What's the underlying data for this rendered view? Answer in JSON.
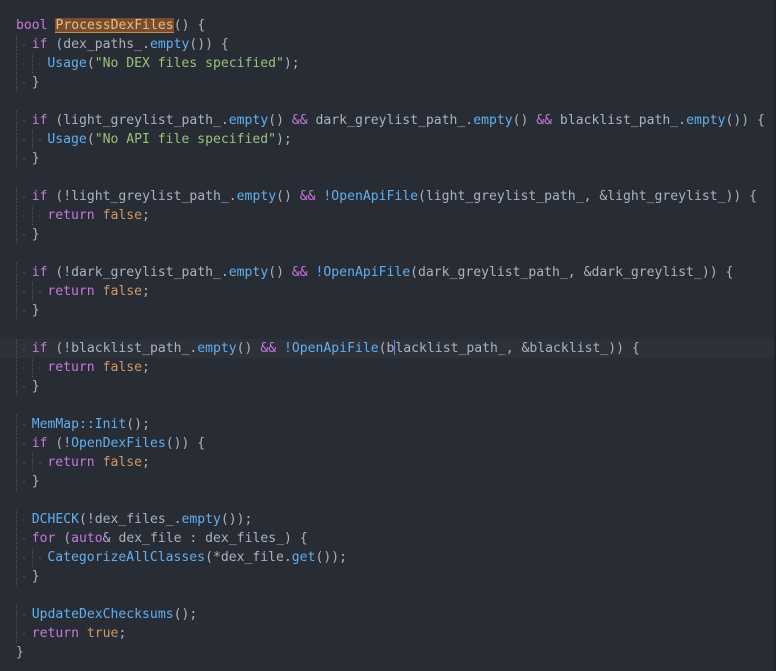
{
  "editor": {
    "language": "cpp",
    "theme": {
      "background": "#282c34",
      "current_line": "#2c313a",
      "keyword": "#c678dd",
      "function": "#61afef",
      "string": "#98c379",
      "constant": "#d19a66",
      "highlight": "#7a4d2e"
    },
    "lines": [
      {
        "indent": 0,
        "tokens": [
          [
            "kw",
            "bool"
          ],
          [
            "txt",
            " "
          ],
          [
            "hl",
            "ProcessDexFiles"
          ],
          [
            "txt",
            "() {"
          ]
        ]
      },
      {
        "indent": 1,
        "tokens": [
          [
            "kw",
            "if"
          ],
          [
            "txt",
            " (dex_paths_."
          ],
          [
            "fn",
            "empty"
          ],
          [
            "txt",
            "()) {"
          ]
        ]
      },
      {
        "indent": 2,
        "tokens": [
          [
            "fn",
            "Usage"
          ],
          [
            "txt",
            "("
          ],
          [
            "str",
            "\"No DEX files specified\""
          ],
          [
            "txt",
            ");"
          ]
        ]
      },
      {
        "indent": 1,
        "tokens": [
          [
            "txt",
            "}"
          ]
        ]
      },
      {
        "indent": 0,
        "tokens": []
      },
      {
        "indent": 1,
        "tokens": [
          [
            "kw",
            "if"
          ],
          [
            "txt",
            " (light_greylist_path_."
          ],
          [
            "fn",
            "empty"
          ],
          [
            "txt",
            "() "
          ],
          [
            "kw",
            "&&"
          ],
          [
            "txt",
            " dark_greylist_path_."
          ],
          [
            "fn",
            "empty"
          ],
          [
            "txt",
            "() "
          ],
          [
            "kw",
            "&&"
          ],
          [
            "txt",
            " blacklist_path_."
          ],
          [
            "fn",
            "empty"
          ],
          [
            "txt",
            "()) {"
          ]
        ]
      },
      {
        "indent": 2,
        "tokens": [
          [
            "fn",
            "Usage"
          ],
          [
            "txt",
            "("
          ],
          [
            "str",
            "\"No API file specified\""
          ],
          [
            "txt",
            ");"
          ]
        ]
      },
      {
        "indent": 1,
        "tokens": [
          [
            "txt",
            "}"
          ]
        ]
      },
      {
        "indent": 0,
        "tokens": []
      },
      {
        "indent": 1,
        "tokens": [
          [
            "kw",
            "if"
          ],
          [
            "txt",
            " (!light_greylist_path_."
          ],
          [
            "fn",
            "empty"
          ],
          [
            "txt",
            "() "
          ],
          [
            "kw",
            "&&"
          ],
          [
            "txt",
            " "
          ],
          [
            "fn",
            "!OpenApiFile"
          ],
          [
            "txt",
            "(light_greylist_path_, &light_greylist_)) {"
          ]
        ]
      },
      {
        "indent": 2,
        "tokens": [
          [
            "kw",
            "return"
          ],
          [
            "txt",
            " "
          ],
          [
            "bool",
            "false"
          ],
          [
            "txt",
            ";"
          ]
        ]
      },
      {
        "indent": 1,
        "tokens": [
          [
            "txt",
            "}"
          ]
        ]
      },
      {
        "indent": 0,
        "tokens": []
      },
      {
        "indent": 1,
        "tokens": [
          [
            "kw",
            "if"
          ],
          [
            "txt",
            " (!dark_greylist_path_."
          ],
          [
            "fn",
            "empty"
          ],
          [
            "txt",
            "() "
          ],
          [
            "kw",
            "&&"
          ],
          [
            "txt",
            " "
          ],
          [
            "fn",
            "!OpenApiFile"
          ],
          [
            "txt",
            "(dark_greylist_path_, &dark_greylist_)) {"
          ]
        ]
      },
      {
        "indent": 2,
        "tokens": [
          [
            "kw",
            "return"
          ],
          [
            "txt",
            " "
          ],
          [
            "bool",
            "false"
          ],
          [
            "txt",
            ";"
          ]
        ]
      },
      {
        "indent": 1,
        "tokens": [
          [
            "txt",
            "}"
          ]
        ]
      },
      {
        "indent": 0,
        "tokens": []
      },
      {
        "indent": 1,
        "current": true,
        "tokens": [
          [
            "kw",
            "if"
          ],
          [
            "txt",
            " (!blacklist_path_."
          ],
          [
            "fn",
            "empty"
          ],
          [
            "txt",
            "() "
          ],
          [
            "kw",
            "&&"
          ],
          [
            "txt",
            " "
          ],
          [
            "fn",
            "!OpenApiFile"
          ],
          [
            "txt",
            "(b"
          ],
          [
            "cursor",
            ""
          ],
          [
            "txt",
            "lacklist_path_, &blacklist_)) {"
          ]
        ]
      },
      {
        "indent": 2,
        "tokens": [
          [
            "kw",
            "return"
          ],
          [
            "txt",
            " "
          ],
          [
            "bool",
            "false"
          ],
          [
            "txt",
            ";"
          ]
        ]
      },
      {
        "indent": 1,
        "tokens": [
          [
            "txt",
            "}"
          ]
        ]
      },
      {
        "indent": 0,
        "tokens": []
      },
      {
        "indent": 1,
        "tokens": [
          [
            "fn",
            "MemMap::Init"
          ],
          [
            "txt",
            "();"
          ]
        ]
      },
      {
        "indent": 1,
        "tokens": [
          [
            "kw",
            "if"
          ],
          [
            "txt",
            " (!"
          ],
          [
            "fn",
            "OpenDexFiles"
          ],
          [
            "txt",
            "()) {"
          ]
        ]
      },
      {
        "indent": 2,
        "tokens": [
          [
            "kw",
            "return"
          ],
          [
            "txt",
            " "
          ],
          [
            "bool",
            "false"
          ],
          [
            "txt",
            ";"
          ]
        ]
      },
      {
        "indent": 1,
        "tokens": [
          [
            "txt",
            "}"
          ]
        ]
      },
      {
        "indent": 0,
        "tokens": []
      },
      {
        "indent": 1,
        "tokens": [
          [
            "fn",
            "DCHECK"
          ],
          [
            "txt",
            "(!dex_files_."
          ],
          [
            "fn",
            "empty"
          ],
          [
            "txt",
            "());"
          ]
        ]
      },
      {
        "indent": 1,
        "tokens": [
          [
            "kw",
            "for"
          ],
          [
            "txt",
            " ("
          ],
          [
            "kw",
            "auto"
          ],
          [
            "txt",
            "& dex_file : dex_files_) {"
          ]
        ]
      },
      {
        "indent": 2,
        "tokens": [
          [
            "fn",
            "CategorizeAllClasses"
          ],
          [
            "txt",
            "(*dex_file."
          ],
          [
            "fn",
            "get"
          ],
          [
            "txt",
            "());"
          ]
        ]
      },
      {
        "indent": 1,
        "tokens": [
          [
            "txt",
            "}"
          ]
        ]
      },
      {
        "indent": 0,
        "tokens": []
      },
      {
        "indent": 1,
        "tokens": [
          [
            "fn",
            "UpdateDexChecksums"
          ],
          [
            "txt",
            "();"
          ]
        ]
      },
      {
        "indent": 1,
        "tokens": [
          [
            "kw",
            "return"
          ],
          [
            "txt",
            " "
          ],
          [
            "bool",
            "true"
          ],
          [
            "txt",
            ";"
          ]
        ]
      },
      {
        "indent": 0,
        "tokens": [
          [
            "txt",
            "}"
          ]
        ]
      }
    ]
  }
}
